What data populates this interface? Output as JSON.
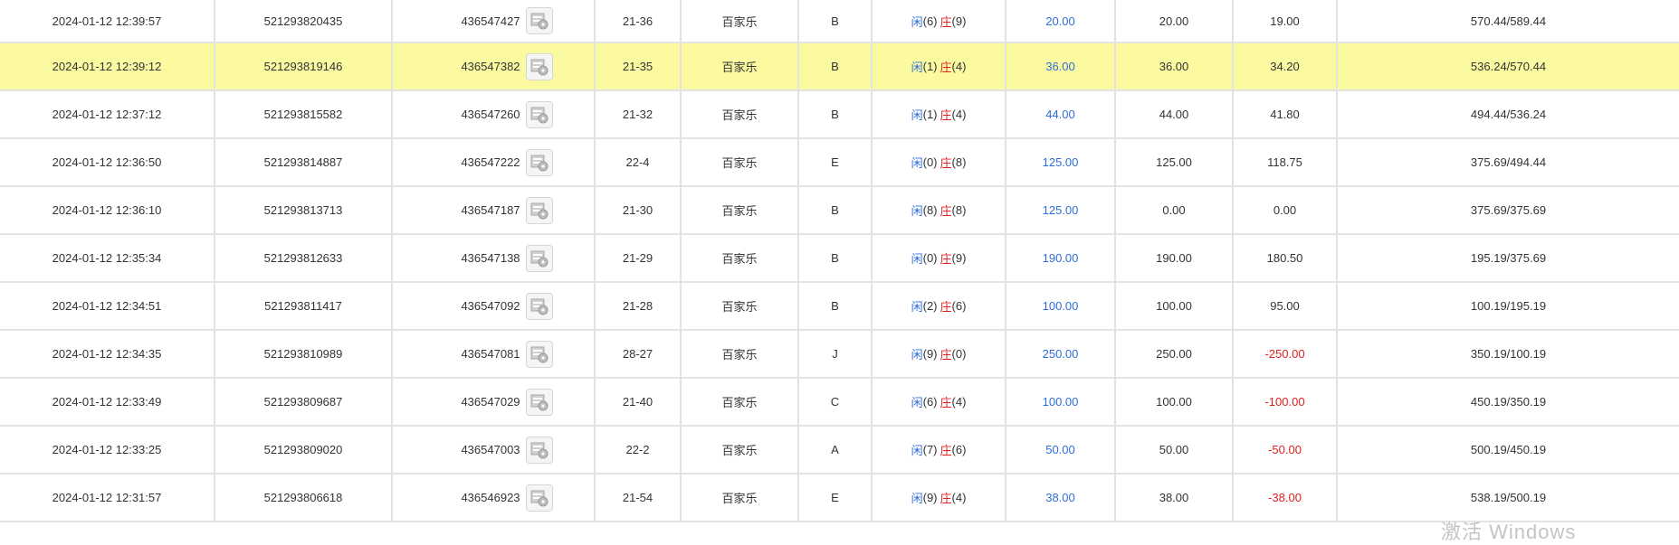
{
  "labels": {
    "player": "闲",
    "banker": "庄"
  },
  "watermark": "激活 Windows",
  "rows": [
    {
      "time": "2024-01-12 12:39:57",
      "order": "521293820435",
      "round": "436547427",
      "table": "21-36",
      "game": "百家乐",
      "bet": "B",
      "p": "(6)",
      "b": "(9)",
      "amount": "20.00",
      "valid": "20.00",
      "win": "19.00",
      "win_neg": false,
      "balance": "570.44/589.44",
      "highlight": false
    },
    {
      "time": "2024-01-12 12:39:12",
      "order": "521293819146",
      "round": "436547382",
      "table": "21-35",
      "game": "百家乐",
      "bet": "B",
      "p": "(1)",
      "b": "(4)",
      "amount": "36.00",
      "valid": "36.00",
      "win": "34.20",
      "win_neg": false,
      "balance": "536.24/570.44",
      "highlight": true
    },
    {
      "time": "2024-01-12 12:37:12",
      "order": "521293815582",
      "round": "436547260",
      "table": "21-32",
      "game": "百家乐",
      "bet": "B",
      "p": "(1)",
      "b": "(4)",
      "amount": "44.00",
      "valid": "44.00",
      "win": "41.80",
      "win_neg": false,
      "balance": "494.44/536.24",
      "highlight": false
    },
    {
      "time": "2024-01-12 12:36:50",
      "order": "521293814887",
      "round": "436547222",
      "table": "22-4",
      "game": "百家乐",
      "bet": "E",
      "p": "(0)",
      "b": "(8)",
      "amount": "125.00",
      "valid": "125.00",
      "win": "118.75",
      "win_neg": false,
      "balance": "375.69/494.44",
      "highlight": false
    },
    {
      "time": "2024-01-12 12:36:10",
      "order": "521293813713",
      "round": "436547187",
      "table": "21-30",
      "game": "百家乐",
      "bet": "B",
      "p": "(8)",
      "b": "(8)",
      "amount": "125.00",
      "valid": "0.00",
      "win": "0.00",
      "win_neg": false,
      "balance": "375.69/375.69",
      "highlight": false
    },
    {
      "time": "2024-01-12 12:35:34",
      "order": "521293812633",
      "round": "436547138",
      "table": "21-29",
      "game": "百家乐",
      "bet": "B",
      "p": "(0)",
      "b": "(9)",
      "amount": "190.00",
      "valid": "190.00",
      "win": "180.50",
      "win_neg": false,
      "balance": "195.19/375.69",
      "highlight": false
    },
    {
      "time": "2024-01-12 12:34:51",
      "order": "521293811417",
      "round": "436547092",
      "table": "21-28",
      "game": "百家乐",
      "bet": "B",
      "p": "(2)",
      "b": "(6)",
      "amount": "100.00",
      "valid": "100.00",
      "win": "95.00",
      "win_neg": false,
      "balance": "100.19/195.19",
      "highlight": false
    },
    {
      "time": "2024-01-12 12:34:35",
      "order": "521293810989",
      "round": "436547081",
      "table": "28-27",
      "game": "百家乐",
      "bet": "J",
      "p": "(9)",
      "b": "(0)",
      "amount": "250.00",
      "valid": "250.00",
      "win": "-250.00",
      "win_neg": true,
      "balance": "350.19/100.19",
      "highlight": false
    },
    {
      "time": "2024-01-12 12:33:49",
      "order": "521293809687",
      "round": "436547029",
      "table": "21-40",
      "game": "百家乐",
      "bet": "C",
      "p": "(6)",
      "b": "(4)",
      "amount": "100.00",
      "valid": "100.00",
      "win": "-100.00",
      "win_neg": true,
      "balance": "450.19/350.19",
      "highlight": false
    },
    {
      "time": "2024-01-12 12:33:25",
      "order": "521293809020",
      "round": "436547003",
      "table": "22-2",
      "game": "百家乐",
      "bet": "A",
      "p": "(7)",
      "b": "(6)",
      "amount": "50.00",
      "valid": "50.00",
      "win": "-50.00",
      "win_neg": true,
      "balance": "500.19/450.19",
      "highlight": false
    },
    {
      "time": "2024-01-12 12:31:57",
      "order": "521293806618",
      "round": "436546923",
      "table": "21-54",
      "game": "百家乐",
      "bet": "E",
      "p": "(9)",
      "b": "(4)",
      "amount": "38.00",
      "valid": "38.00",
      "win": "-38.00",
      "win_neg": true,
      "balance": "538.19/500.19",
      "highlight": false
    }
  ]
}
